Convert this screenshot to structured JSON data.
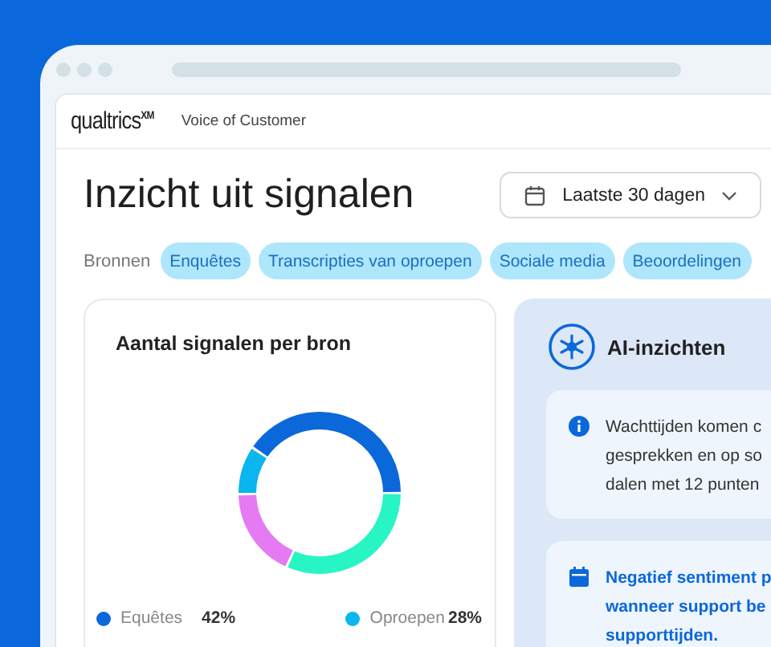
{
  "header": {
    "logo": "qualtrics",
    "logo_mark": "XM",
    "product": "Voice of Customer"
  },
  "title": "Inzicht uit signalen",
  "date_button": {
    "label": "Laatste 30 dagen"
  },
  "sources": {
    "label": "Bronnen",
    "chips": [
      "Enquêtes",
      "Transcripties van oproepen",
      "Sociale media",
      "Beoordelingen"
    ]
  },
  "chart_card": {
    "title": "Aantal signalen per bron",
    "legend": [
      {
        "label": "Equêtes",
        "value": "42%",
        "color": "#0b68db"
      },
      {
        "label": "Oproepen",
        "value": "28%",
        "color": "#0bb5ee"
      }
    ]
  },
  "insights": {
    "title": "AI-inzichten",
    "cards": [
      {
        "kind": "info",
        "lines": [
          "Wachttijden komen c",
          "gesprekken en op so",
          "dalen met 12 punten"
        ]
      },
      {
        "kind": "calendar",
        "lines": [
          "Negatief sentiment p",
          "wanneer support be",
          "supporttijden."
        ]
      }
    ]
  }
}
